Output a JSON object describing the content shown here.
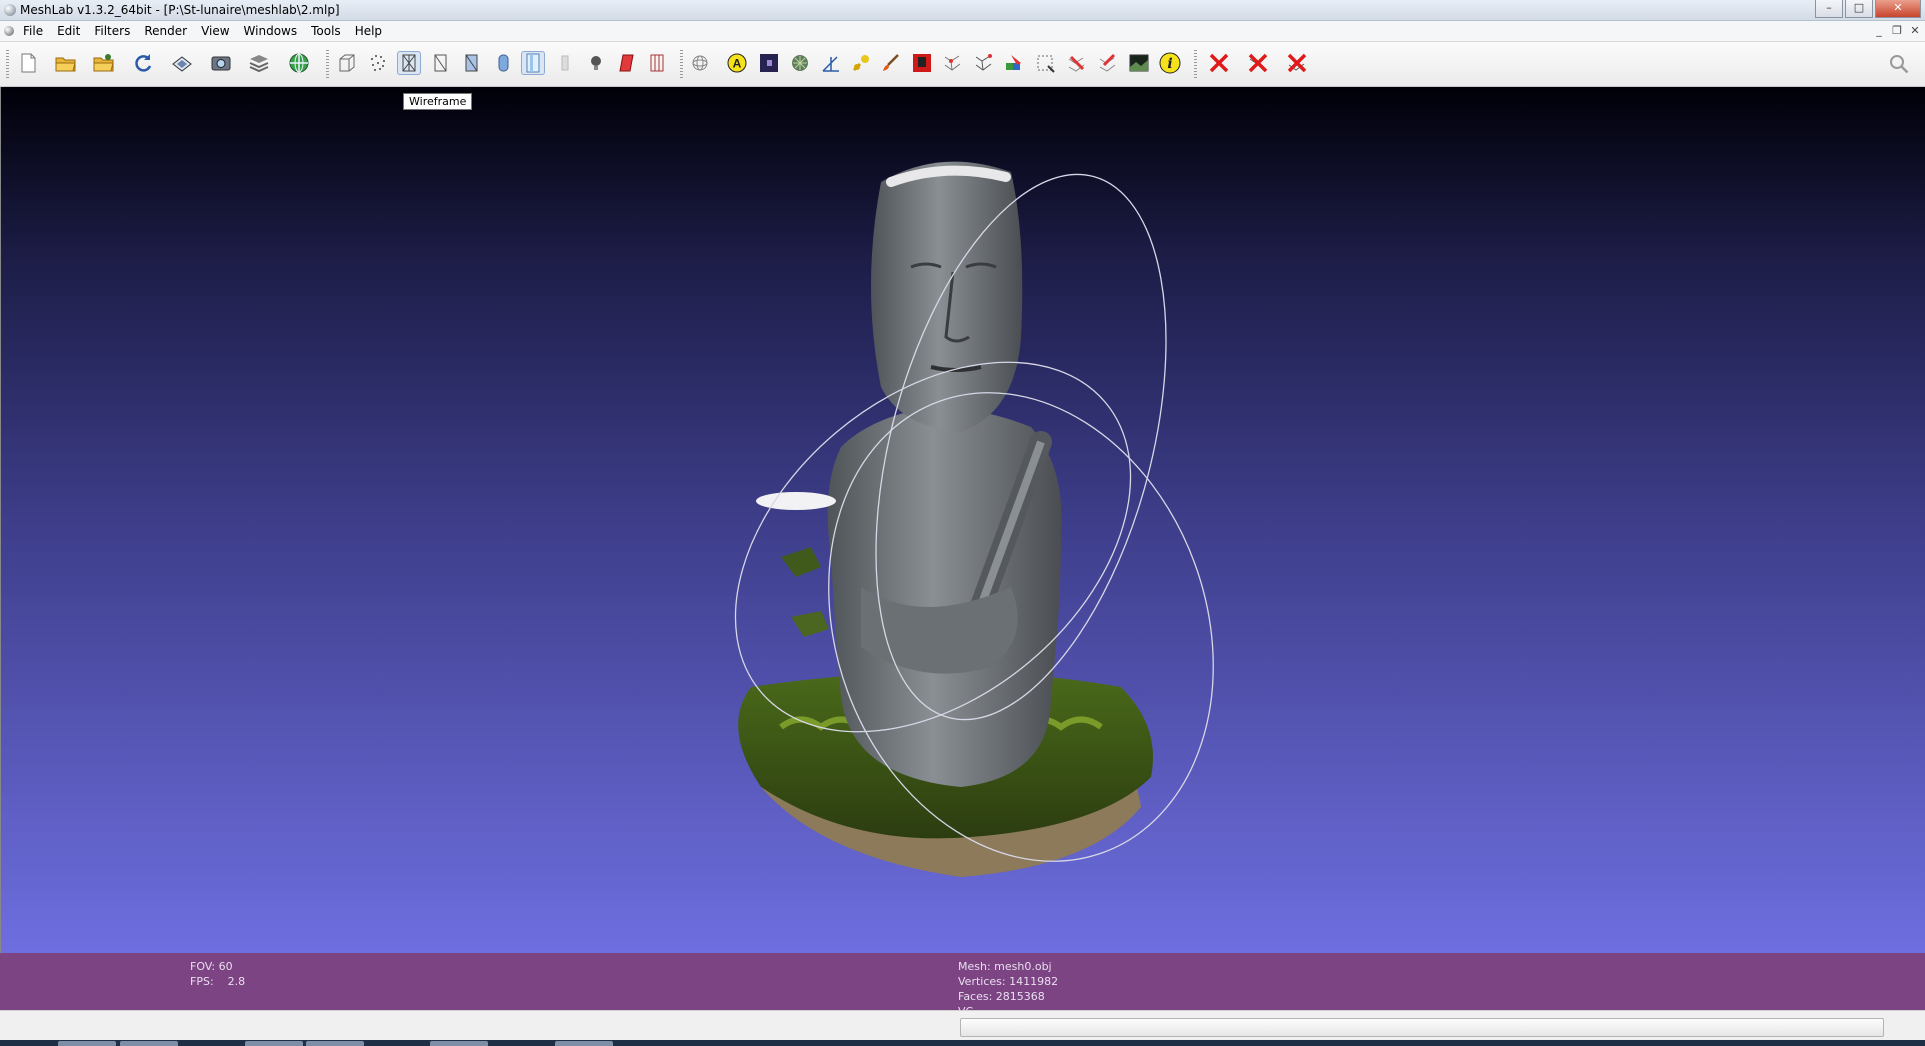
{
  "window": {
    "title": "MeshLab v1.3.2_64bit - [P:\\St-lunaire\\meshlab\\2.mlp]",
    "controls": [
      "minimize",
      "maximize",
      "close"
    ]
  },
  "menu": {
    "items": [
      "File",
      "Edit",
      "Filters",
      "Render",
      "View",
      "Windows",
      "Tools",
      "Help"
    ]
  },
  "toolbar": {
    "tooltip": "Wireframe",
    "active_tool": "wireframe",
    "icons": [
      "new-document-icon",
      "open-folder-icon",
      "open-project-icon",
      "reload-icon",
      "save-icon",
      "snapshot-icon",
      "layers-icon",
      "globe-icon",
      "bounding-box-icon",
      "points-icon",
      "wireframe-icon",
      "hidden-lines-icon",
      "flat-shading-icon",
      "smooth-shading-icon",
      "texture-icon",
      "light-bulb-icon",
      "backface-culling-icon",
      "select-vertices-icon",
      "trackball-icon",
      "annotation-icon",
      "raster-icon",
      "texture-pattern-icon",
      "measure-icon",
      "paint-icon",
      "brush-icon",
      "select-faces-icon",
      "select-connected-icon",
      "select-vertex-icon",
      "color-paint-icon",
      "select-region-icon",
      "move-icon",
      "align-icon",
      "image-icon",
      "info-icon",
      "delete-selected-icon",
      "delete-vertices-icon",
      "delete-faces-icon",
      "search-icon"
    ]
  },
  "viewport": {
    "background_top": "#000008",
    "background_bottom": "#6e6ee0",
    "model": "stone-statue-mesh"
  },
  "info": {
    "fov_label": "FOV:",
    "fov_value": "60",
    "fps_label": "FPS:",
    "fps_value": "2.8",
    "mesh_line": "Mesh: mesh0.obj",
    "vertices_line": "Vertices: 1411982",
    "faces_line": "Faces: 2815368",
    "flags_line": "VC"
  },
  "colors": {
    "infobar": "#7c4483",
    "info_text": "#e9dff0"
  }
}
